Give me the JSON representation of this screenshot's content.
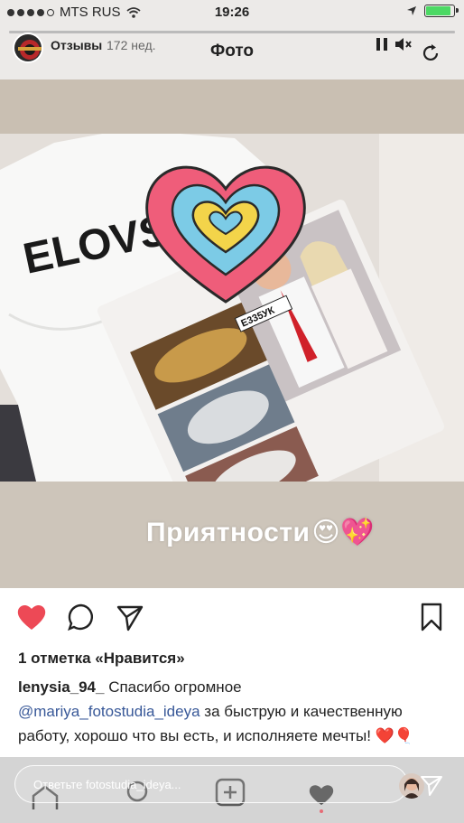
{
  "status_bar": {
    "carrier": "MTS RUS",
    "time": "19:26",
    "battery_level": 0.9
  },
  "story": {
    "username": "Отзывы",
    "time_ago": "172 нед.",
    "title": "Фото",
    "progress": 1.0,
    "photo_text": "ELOVSKIH",
    "plate_text": "Е335УК",
    "caption": "Приятности",
    "caption_emoji": "😍💖"
  },
  "post": {
    "likes": "1 отметка «Нравится»",
    "comment_author": "lenysia_94_",
    "comment_line1": "Спасибо огромное",
    "mention": "@mariya_fotostudia_ideya",
    "comment_rest": "за быструю и качественную работу, хорошо что вы есть, и исполняете мечты!",
    "comment_emoji": "❤️🎈"
  },
  "reply": {
    "placeholder": "Ответьте fotostudia_ideya..."
  },
  "icons": {
    "like": "heart-filled-icon",
    "comment": "comment-bubble-icon",
    "share": "paper-plane-icon",
    "save": "bookmark-icon",
    "pause": "pause-icon",
    "mute": "mute-icon",
    "refresh": "refresh-icon",
    "send": "send-icon"
  },
  "colors": {
    "like_red": "#ed4956",
    "mention_blue": "#385898",
    "heart_pink": "#ef5d7a",
    "heart_blue": "#7ccbe6",
    "heart_yellow": "#f3d44a"
  }
}
